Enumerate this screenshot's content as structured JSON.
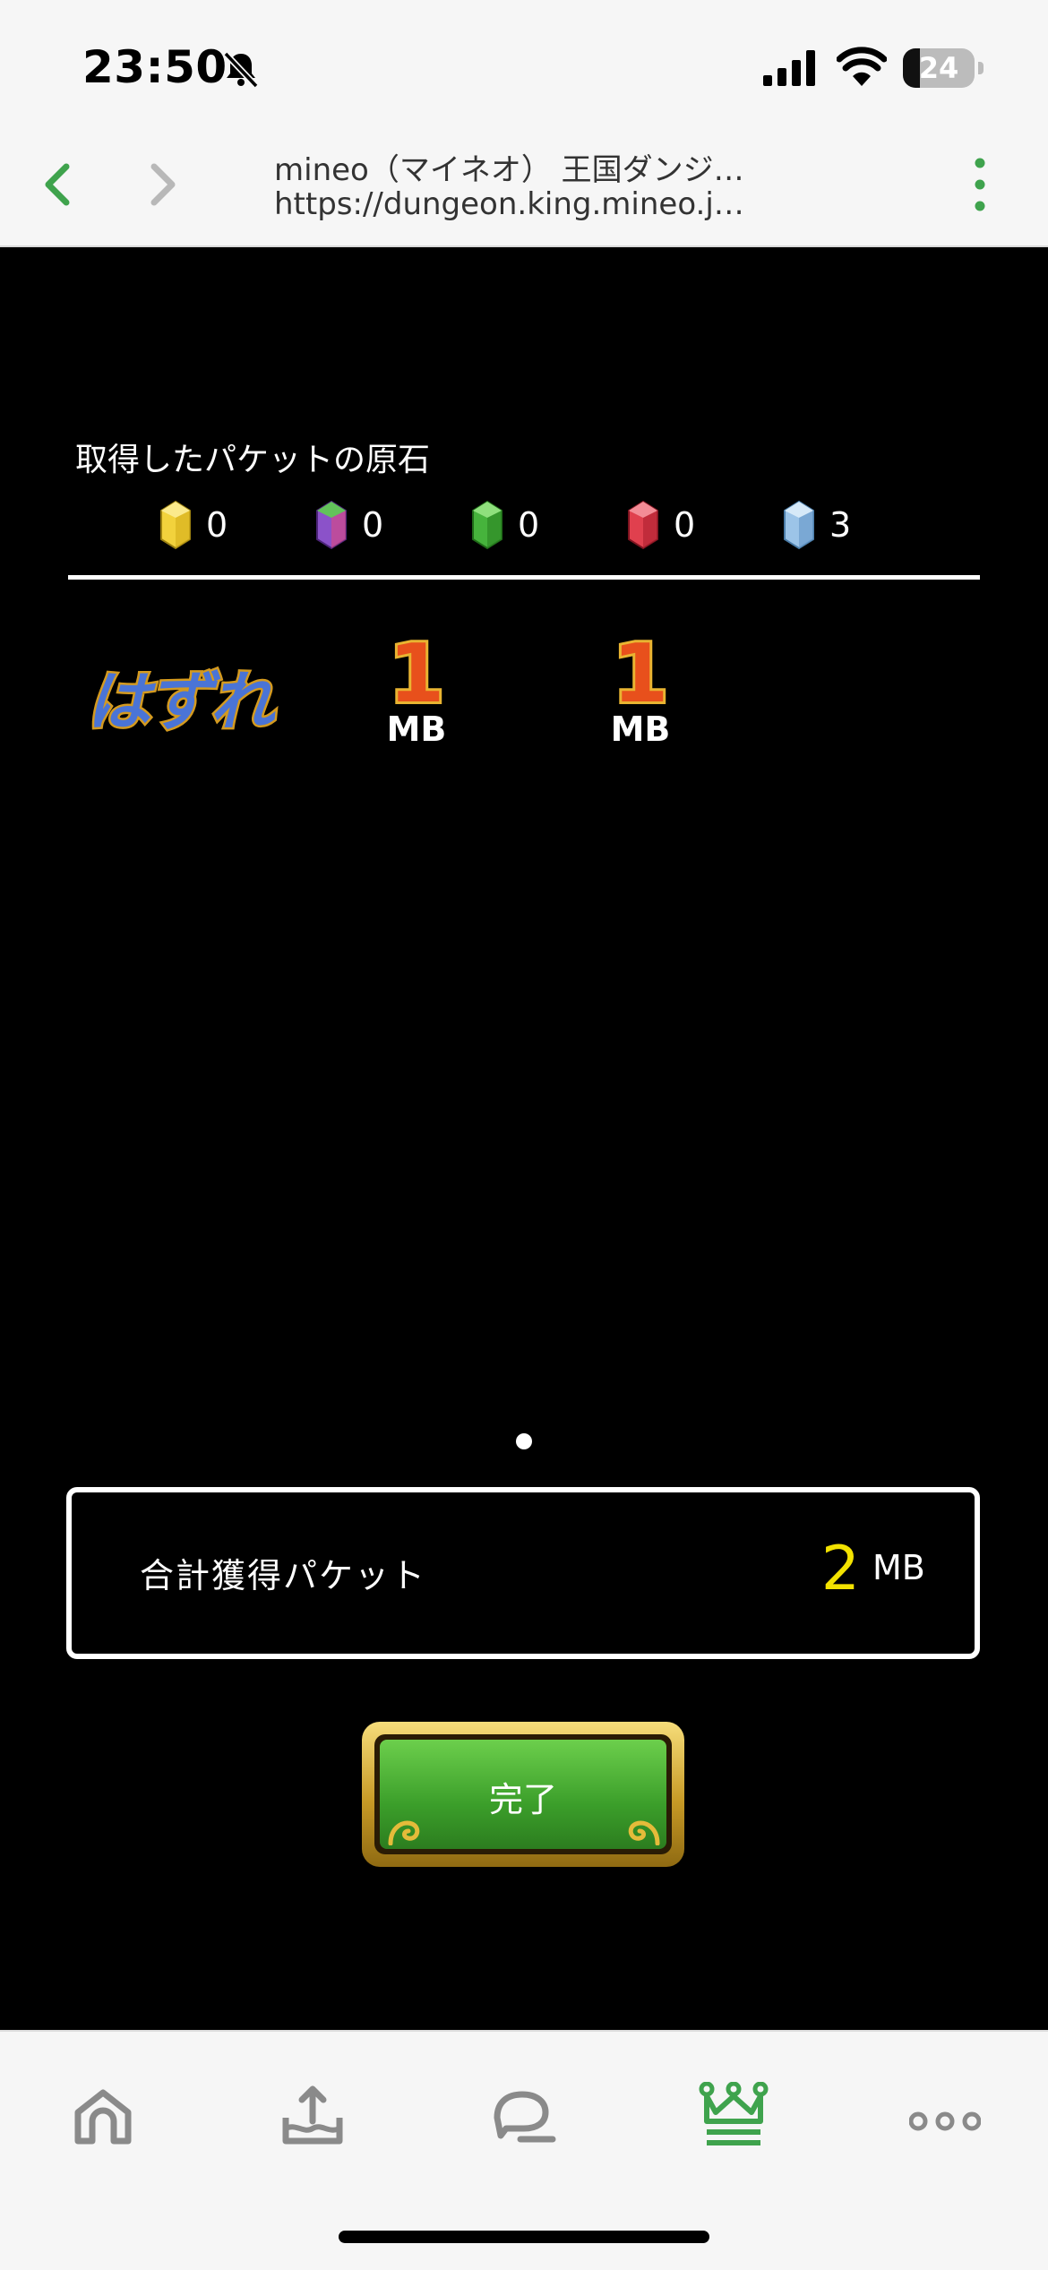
{
  "status_bar": {
    "time": "23:50",
    "battery_level": "24",
    "battery_fraction": 0.24,
    "icons": [
      "bell-slash-icon",
      "cellular-signal-icon",
      "wifi-icon",
      "battery-icon"
    ]
  },
  "browser": {
    "page_title": "mineo（マイネオ） 王国ダンジ…",
    "url": "https://dungeon.king.mineo.j…",
    "icons": [
      "back-arrow-icon",
      "forward-arrow-icon",
      "more-vertical-icon"
    ],
    "accent_color": "#3fa34d"
  },
  "game": {
    "stones_title": "取得したパケットの原石",
    "stones": [
      {
        "color_name": "yellow",
        "color": "#f2d23c",
        "count": "0"
      },
      {
        "color_name": "purple",
        "color": "#8b52c9",
        "count": "0"
      },
      {
        "color_name": "green",
        "color": "#46b33c",
        "count": "0"
      },
      {
        "color_name": "red",
        "color": "#e0404e",
        "count": "0"
      },
      {
        "color_name": "light-blue",
        "color": "#9cc4e8",
        "count": "3"
      }
    ],
    "results": [
      {
        "type": "miss",
        "label": "はずれ"
      },
      {
        "type": "packet",
        "value": "1",
        "unit": "MB"
      },
      {
        "type": "packet",
        "value": "1",
        "unit": "MB"
      }
    ],
    "total": {
      "label": "合計獲得パケット",
      "value": "2",
      "unit": "MB"
    },
    "done_button_label": "完了"
  },
  "tab_bar": {
    "tabs": [
      {
        "name": "home",
        "icon": "home-icon",
        "active": false
      },
      {
        "name": "upload",
        "icon": "upload-tray-icon",
        "active": false
      },
      {
        "name": "chat",
        "icon": "chat-bubble-icon",
        "active": false
      },
      {
        "name": "dungeon",
        "icon": "crown-icon",
        "active": true
      },
      {
        "name": "more",
        "icon": "more-horizontal-icon",
        "active": false
      }
    ],
    "active_color": "#3fa34d",
    "inactive_color": "#8a8a8a"
  }
}
